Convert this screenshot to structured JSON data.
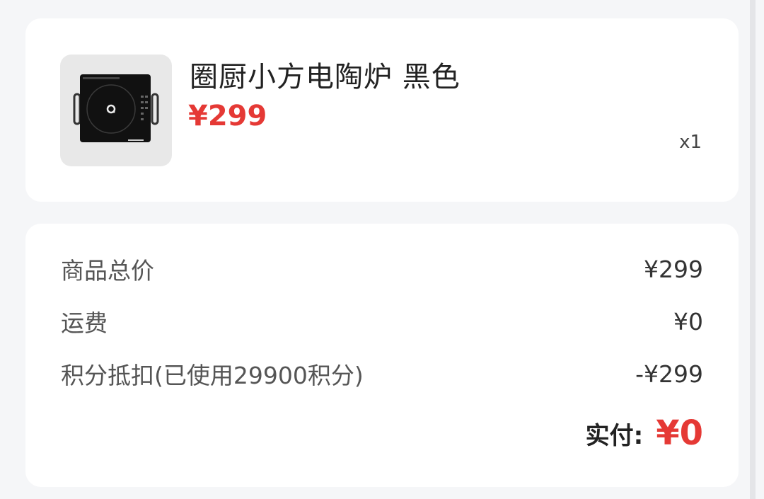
{
  "product": {
    "title": "圈厨小方电陶炉 黑色",
    "price": "¥299",
    "quantity": "x1",
    "image_icon": "induction-cooker-icon"
  },
  "summary": {
    "rows": [
      {
        "label": "商品总价",
        "value": "¥299"
      },
      {
        "label": "运费",
        "value": "¥0"
      },
      {
        "label": "积分抵扣(已使用29900积分)",
        "value": "-¥299"
      }
    ],
    "total_label": "实付:",
    "total_value": "¥0"
  },
  "colors": {
    "accent": "#e53935",
    "background": "#f5f6f8",
    "card": "#ffffff"
  }
}
